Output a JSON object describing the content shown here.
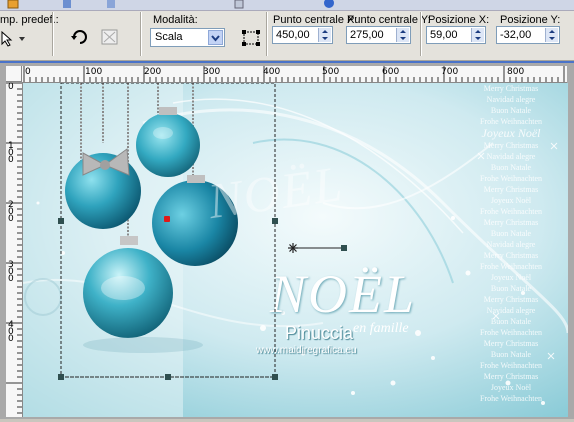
{
  "toolbar": {
    "preset_label": "mp. predef.:",
    "mode_label": "Modalità:",
    "mode_value": "Scala",
    "center_x_label": "Punto centrale X:",
    "center_x_value": "450,00",
    "center_y_label": "Punto centrale Y:",
    "center_y_value": "275,00",
    "pos_x_label": "Posizione X:",
    "pos_x_value": "59,00",
    "pos_y_label": "Posizione Y:",
    "pos_y_value": "-32,00"
  },
  "ruler": {
    "h_labels": [
      "0",
      "100",
      "200",
      "300",
      "400",
      "500",
      "600",
      "700",
      "800"
    ],
    "v_labels": [
      "0",
      "1 0 0",
      "2 0 0",
      "3 0 0",
      "4 0 0"
    ]
  },
  "image_text": {
    "noel_small": "NOËL",
    "noel_big": "NOËL",
    "en_famille": "en famille",
    "joyeux": "Joyeux Noël",
    "signature": "Pinuccia",
    "website": "www.maidiregrafica.eu",
    "greetings": [
      "Merry Christmas",
      "Navidad alegre",
      "Buon Natale",
      "Frohe Weihnachten",
      "Merry Christmas",
      "Navidad alegre",
      "Buon Natale",
      "Frohe Weihnachten",
      "Merry Christmas",
      "Joyeux Noël",
      "Frohe Weihnachten",
      "Merry Christmas",
      "Buon Natale",
      "Navidad alegre",
      "Merry Christmas",
      "Frohe Weihnachten",
      "Joyeux Noël",
      "Buon Natale"
    ]
  },
  "colors": {
    "accent_blue": "#4a73c9",
    "teal": "#3ab1c6",
    "handle": "#2f4f4f"
  }
}
